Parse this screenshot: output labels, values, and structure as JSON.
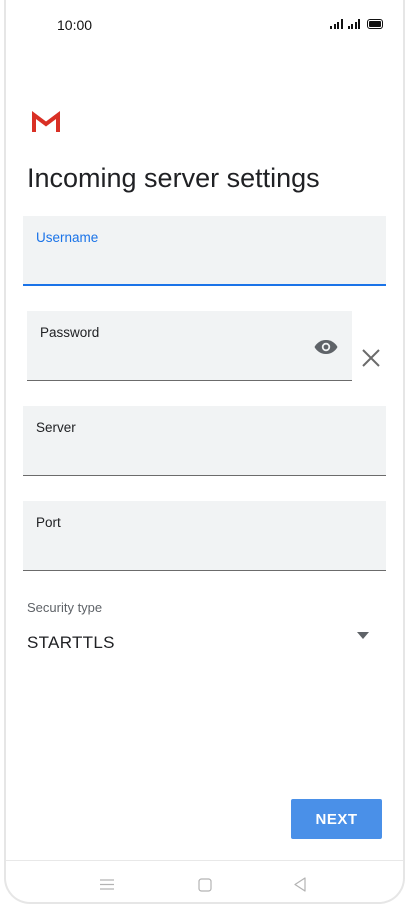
{
  "status_bar": {
    "time": "10:00",
    "icons": [
      "signal-icon",
      "signal-icon",
      "battery-icon"
    ]
  },
  "logo": {
    "icon": "gmail-icon",
    "color": "#d93025"
  },
  "page": {
    "title": "Incoming server settings"
  },
  "fields": {
    "username": {
      "label": "Username",
      "value": "",
      "focused": true
    },
    "password": {
      "label": "Password",
      "value": "",
      "show_icon": "eye-icon",
      "clear_icon": "close-icon"
    },
    "server": {
      "label": "Server",
      "value": ""
    },
    "port": {
      "label": "Port",
      "value": ""
    }
  },
  "security": {
    "label": "Security type",
    "value": "STARTTLS",
    "dropdown_icon": "arrow-drop-down-icon"
  },
  "actions": {
    "next_label": "NEXT"
  },
  "nav_bar": {
    "icons": [
      "menu-icon",
      "home-icon",
      "back-icon"
    ]
  },
  "colors": {
    "accent": "#1a73e8",
    "button": "#4a90e8",
    "field_bg": "#f1f3f4",
    "text": "#202124"
  }
}
